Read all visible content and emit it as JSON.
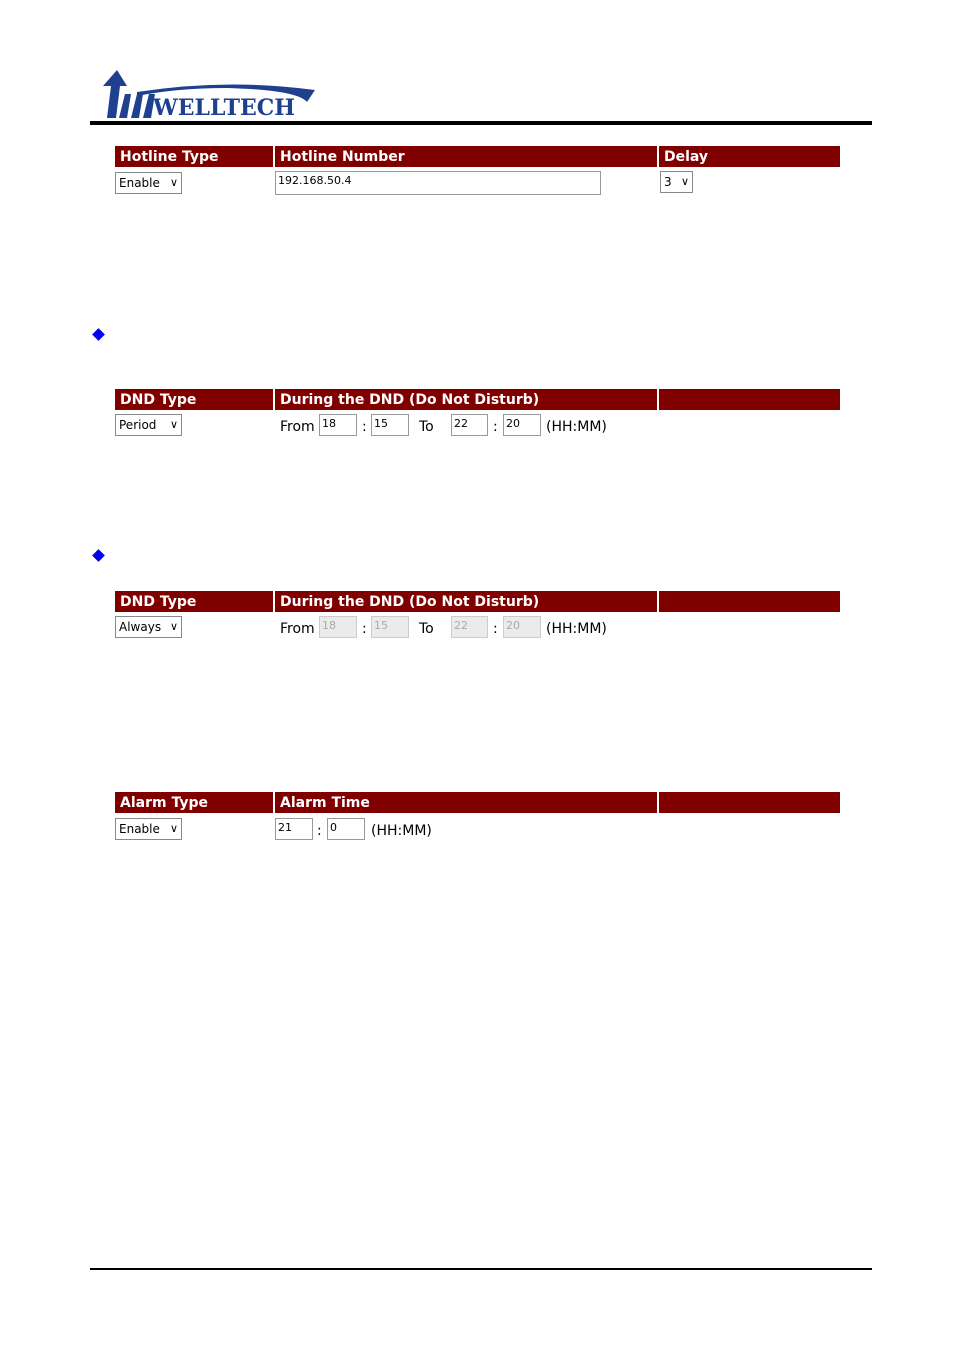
{
  "logo": {
    "text": "WELLTECH",
    "color": "#1f3f8f"
  },
  "colors": {
    "header_bg": "#800000",
    "bullet": "#0000ee"
  },
  "hotline": {
    "headers": [
      "Hotline Type",
      "Hotline Number",
      "Delay"
    ],
    "type": "Enable",
    "number": "192.168.50.4",
    "delay": "3"
  },
  "dnd_period": {
    "headers": [
      "DND Type",
      "During the DND (Do Not Disturb)",
      ""
    ],
    "type": "Period",
    "from_label": "From",
    "to_label": "To",
    "sep": ":",
    "from_h": "18",
    "from_m": "15",
    "to_h": "22",
    "to_m": "20",
    "format": "(HH:MM)"
  },
  "dnd_always": {
    "headers": [
      "DND Type",
      "During the DND (Do Not Disturb)",
      ""
    ],
    "type": "Always",
    "from_label": "From",
    "to_label": "To",
    "sep": ":",
    "from_h": "18",
    "from_m": "15",
    "to_h": "22",
    "to_m": "20",
    "format": "(HH:MM)"
  },
  "alarm": {
    "headers": [
      "Alarm Type",
      "Alarm Time",
      ""
    ],
    "type": "Enable",
    "hour": "21",
    "minute": "0",
    "sep": ":",
    "format": "(HH:MM)"
  }
}
